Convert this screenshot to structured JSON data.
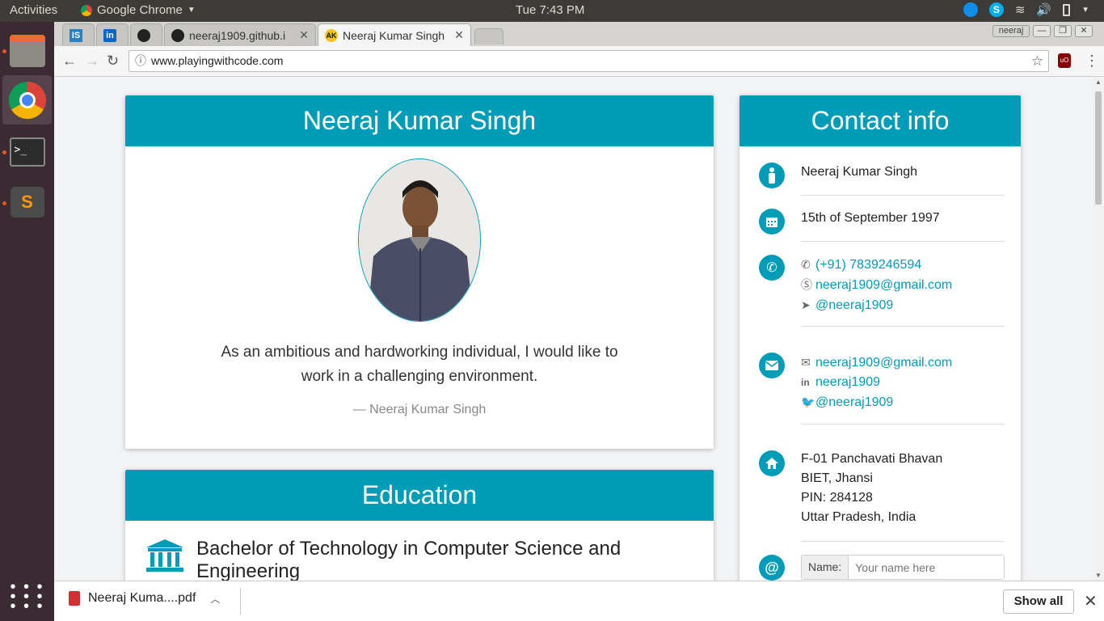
{
  "topbar": {
    "activities": "Activities",
    "app_name": "Google Chrome",
    "clock": "Tue  7:43 PM"
  },
  "tabs": [
    {
      "label": ""
    },
    {
      "label": ""
    },
    {
      "label": ""
    },
    {
      "label": "neeraj1909.github.i"
    },
    {
      "label": "Neeraj Kumar Singh"
    }
  ],
  "window": {
    "user_badge": "neeraj"
  },
  "address_bar": {
    "url": "www.playingwithcode.com"
  },
  "profile": {
    "name": "Neeraj Kumar Singh",
    "quote": "As an ambitious and hardworking individual, I would like to work in a challenging environment.",
    "citation": "— Neeraj Kumar Singh"
  },
  "education": {
    "heading": "Education",
    "degree": "Bachelor of Technology in Computer Science and Engineering"
  },
  "contact": {
    "heading": "Contact info",
    "name": "Neeraj Kumar Singh",
    "dob": "15th of September 1997",
    "phone": "(+91) 7839246594",
    "skype": "neeraj1909@gmail.com",
    "telegram": "@neeraj1909",
    "email": "neeraj1909@gmail.com",
    "linkedin": "neeraj1909",
    "twitter": "@neeraj1909",
    "address_line1": "F-01 Panchavati Bhavan",
    "address_line2": "BIET, Jhansi",
    "address_line3": "PIN: 284128",
    "address_line4": "Uttar Pradesh, India",
    "form_name_label": "Name:",
    "form_name_placeholder": "Your name here"
  },
  "downloads": {
    "file": "Neeraj Kuma....pdf",
    "show_all": "Show all"
  },
  "colors": {
    "accent": "#019cb7",
    "dock": "#3a2b33",
    "topbar": "#3c3b37"
  }
}
